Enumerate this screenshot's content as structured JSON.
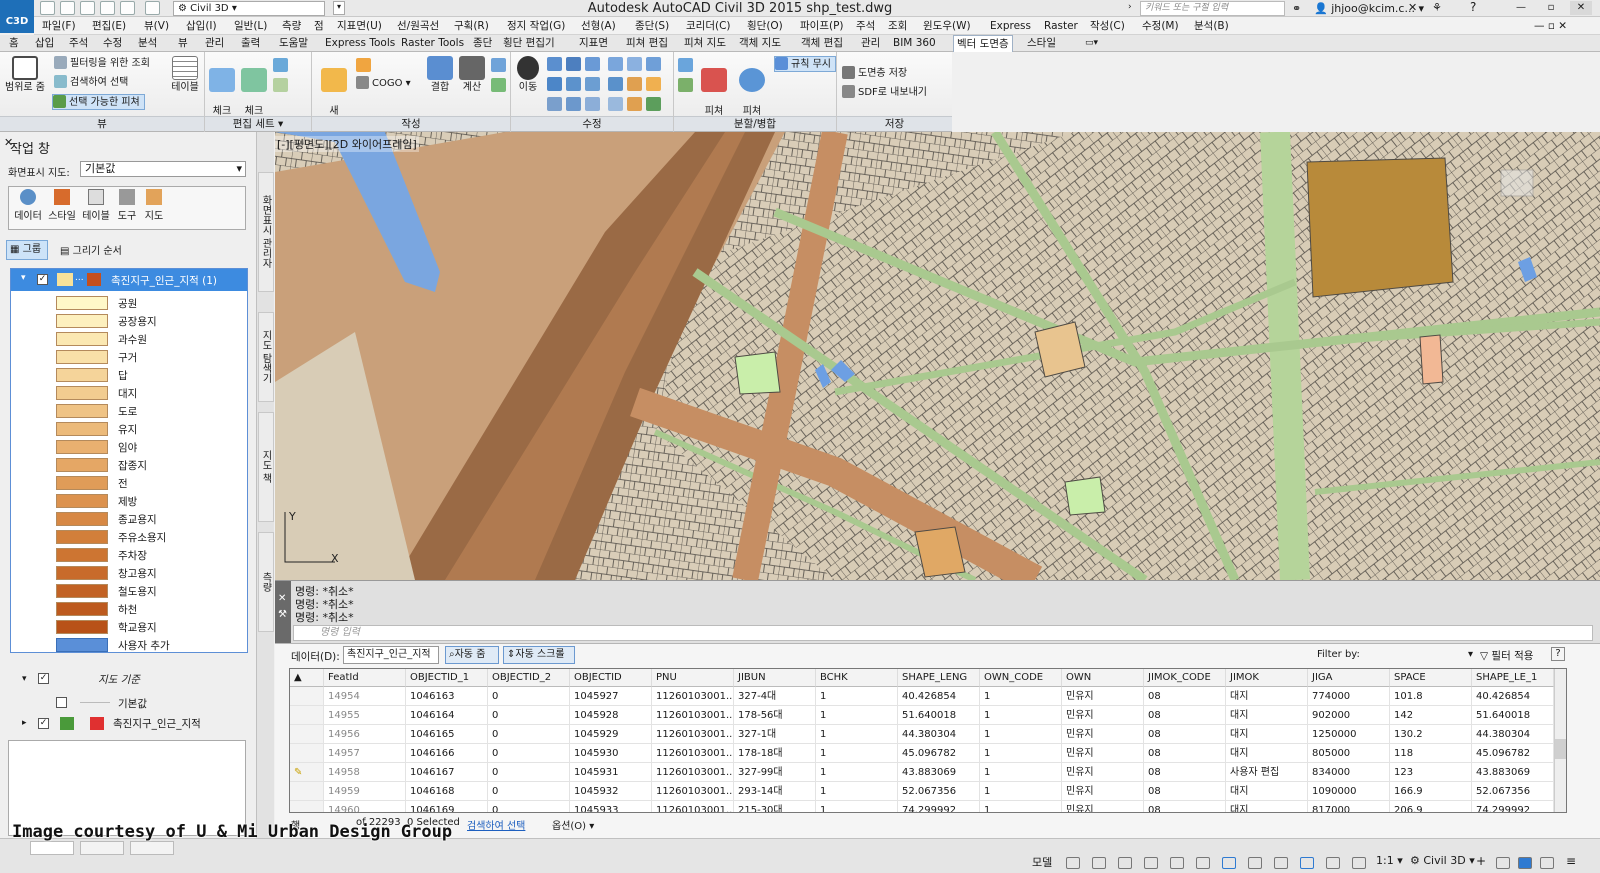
{
  "titlebar": {
    "workspace": "Civil 3D",
    "title": "Autodesk AutoCAD Civil 3D 2015    shp_test.dwg",
    "search_placeholder": "키워드 또는 구절 입력",
    "user": "jhjoo@kcim.c..."
  },
  "menu": [
    "파일(F)",
    "편집(E)",
    "뷰(V)",
    "삽입(I)",
    "일반(L)",
    "측량",
    "점",
    "지표면(U)",
    "선/원곡선",
    "구획(R)",
    "정지 작업(G)",
    "선형(A)",
    "종단(S)",
    "코리더(C)",
    "횡단(O)",
    "파이프(P)",
    "주석",
    "조회",
    "윈도우(W)",
    "Express",
    "Raster",
    "작성(C)",
    "수정(M)",
    "분석(B)"
  ],
  "tabs": [
    "홈",
    "삽입",
    "주석",
    "수정",
    "분석",
    "뷰",
    "관리",
    "출력",
    "도움말",
    "Express Tools",
    "Raster Tools",
    "종단",
    "횡단 편집기",
    "지표면",
    "피쳐 편집",
    "피쳐 지도",
    "객체 지도",
    "객체 편집",
    "관리",
    "BIM 360",
    "벡터 도면층",
    "스타일"
  ],
  "active_tab": "벡터 도면층",
  "ribbon": {
    "zoom_label": "범위로 줌",
    "filter_label": "필터링을 위한 조회",
    "search_select": "검색하여 선택",
    "selectable": "선택 가능한 피쳐",
    "view_label": "뷰",
    "table": "테이블",
    "checkout": "체크\n아웃",
    "checkin": "체크\n인",
    "editset_label": "편집 세트",
    "new_feature": "새\n피쳐",
    "cogo": "COGO",
    "combine": "결합",
    "calc": "계산",
    "create_label": "작성",
    "move": "이동",
    "modify_label": "수정",
    "split": "피쳐\n분할",
    "merge": "피쳐\n병합",
    "rules": "규칙 무시",
    "splitmerge_label": "분할/병합",
    "save_layer": "도면층 저장",
    "export_sdf": "SDF로 내보내기",
    "save_label": "저장"
  },
  "palette": {
    "title": "작업 창",
    "map_label": "화면표시 지도:",
    "map_value": "기본값",
    "tools": [
      "데이터",
      "스타일",
      "테이블",
      "도구",
      "지도"
    ],
    "group": "그룹",
    "draw_order": "그리기 순서",
    "layer_name": "촉진지구_인근_지적 (1)",
    "legend": [
      "공원",
      "공장용지",
      "과수원",
      "구거",
      "답",
      "대지",
      "도로",
      "유지",
      "임야",
      "잡종지",
      "전",
      "제방",
      "종교용지",
      "주유소용지",
      "주차장",
      "창고용지",
      "철도용지",
      "하천",
      "학교용지",
      "사용자 추가"
    ],
    "legend_colors": [
      "#fff8c8",
      "#fdf0be",
      "#fbe8b2",
      "#f9e0a8",
      "#f5d49a",
      "#f2cc90",
      "#efc385",
      "#ecba7a",
      "#e9b070",
      "#e5a765",
      "#e09c58",
      "#dc924e",
      "#d78844",
      "#d27f3a",
      "#cd7532",
      "#c86b2b",
      "#c26224",
      "#bd5a1e",
      "#b85218",
      "#5a8fd8"
    ],
    "map_base": "지도 기준",
    "basic": "기본값",
    "layer2": "촉진지구_인근_지적",
    "side_tabs": [
      "화면표시 관리자",
      "지도 탐색기",
      "지도 책",
      "측량"
    ]
  },
  "viewport_label": "[-][평면도][2D 와이어프레임]",
  "command": {
    "lines": [
      "명령: *취소*",
      "명령: *취소*",
      "명령: *취소*"
    ],
    "placeholder": "명령 입력"
  },
  "datatable": {
    "data_label": "데이터(D):",
    "data_value": "촉진지구_인근_지적",
    "auto_zoom": "자동 줌",
    "auto_scroll": "자동 스크롤",
    "filter_by": "Filter by:",
    "apply_filter": "필터 적용",
    "columns": [
      "FeatId",
      "OBJECTID_1",
      "OBJECTID_2",
      "OBJECTID",
      "PNU",
      "JIBUN",
      "BCHK",
      "SHAPE_LENG",
      "OWN_CODE",
      "OWN",
      "JIMOK_CODE",
      "JIMOK",
      "JIGA",
      "SPACE",
      "SHAPE_LE_1"
    ],
    "rows": [
      [
        "14954",
        "1046163",
        "0",
        "1045927",
        "11260103001...",
        "327-4대",
        "1",
        "40.426854",
        "1",
        "민유지",
        "08",
        "대지",
        "774000",
        "101.8",
        "40.426854"
      ],
      [
        "14955",
        "1046164",
        "0",
        "1045928",
        "11260103001...",
        "178-56대",
        "1",
        "51.640018",
        "1",
        "민유지",
        "08",
        "대지",
        "902000",
        "142",
        "51.640018"
      ],
      [
        "14956",
        "1046165",
        "0",
        "1045929",
        "11260103001...",
        "327-1대",
        "1",
        "44.380304",
        "1",
        "민유지",
        "08",
        "대지",
        "1250000",
        "130.2",
        "44.380304"
      ],
      [
        "14957",
        "1046166",
        "0",
        "1045930",
        "11260103001...",
        "178-18대",
        "1",
        "45.096782",
        "1",
        "민유지",
        "08",
        "대지",
        "805000",
        "118",
        "45.096782"
      ],
      [
        "14958",
        "1046167",
        "0",
        "1045931",
        "11260103001...",
        "327-99대",
        "1",
        "43.883069",
        "1",
        "민유지",
        "08",
        "사용자 편집",
        "834000",
        "123",
        "43.883069"
      ],
      [
        "14959",
        "1046168",
        "0",
        "1045932",
        "11260103001...",
        "293-14대",
        "1",
        "52.067356",
        "1",
        "민유지",
        "08",
        "대지",
        "1090000",
        "166.9",
        "52.067356"
      ],
      [
        "14960",
        "1046169",
        "0",
        "1045933",
        "11260103001...",
        "215-30대",
        "1",
        "74.299992",
        "1",
        "민유지",
        "08",
        "대지",
        "817000",
        "206.9",
        "74.299992"
      ]
    ],
    "row_label": "행",
    "record_count": "of 22293",
    "selected": "0 Selected",
    "search_select": "검색하여 선택",
    "options": "옵션(O)"
  },
  "status": {
    "model": "모델",
    "scale": "1:1",
    "workspace": "Civil 3D"
  },
  "credit": "Image courtesy of U & Mi Urban Design Group"
}
